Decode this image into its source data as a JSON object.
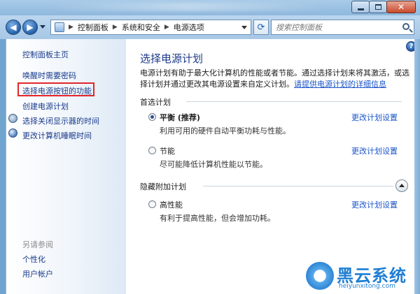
{
  "window": {
    "buttons": {
      "minimize": "–",
      "maximize": "□",
      "close": "✕"
    }
  },
  "address_bar": {
    "crumbs": [
      "控制面板",
      "系统和安全",
      "电源选项"
    ],
    "separator": "▶"
  },
  "search": {
    "placeholder": "搜索控制面板"
  },
  "sidebar": {
    "home": "控制面板主页",
    "links": [
      "唤醒时需要密码",
      "选择电源按钮的功能",
      "创建电源计划",
      "选择关闭显示器的时间",
      "更改计算机睡眠时间"
    ],
    "highlighted_index": 1,
    "see_also_title": "另请参阅",
    "see_also": [
      "个性化",
      "用户帐户"
    ]
  },
  "main": {
    "help": "?",
    "title": "选择电源计划",
    "description": "电源计划有助于最大化计算机的性能或者节能。通过选择计划来将其激活，或选择计划并通过更改其电源设置来自定义计划。",
    "description_link": "请提供电源计划的详细信息",
    "preferred_title": "首选计划",
    "hidden_title": "隐藏附加计划",
    "plans": [
      {
        "name": "平衡 (推荐)",
        "desc": "利用可用的硬件自动平衡功耗与性能。",
        "change": "更改计划设置",
        "selected": true
      },
      {
        "name": "节能",
        "desc": "尽可能降低计算机性能以节能。",
        "change": "更改计划设置",
        "selected": false
      },
      {
        "name": "高性能",
        "desc": "有利于提高性能，但会增加功耗。",
        "change": "更改计划设置",
        "selected": false
      }
    ]
  },
  "watermark": {
    "name": "黑云系统",
    "url": "heiyunxitong.com"
  }
}
